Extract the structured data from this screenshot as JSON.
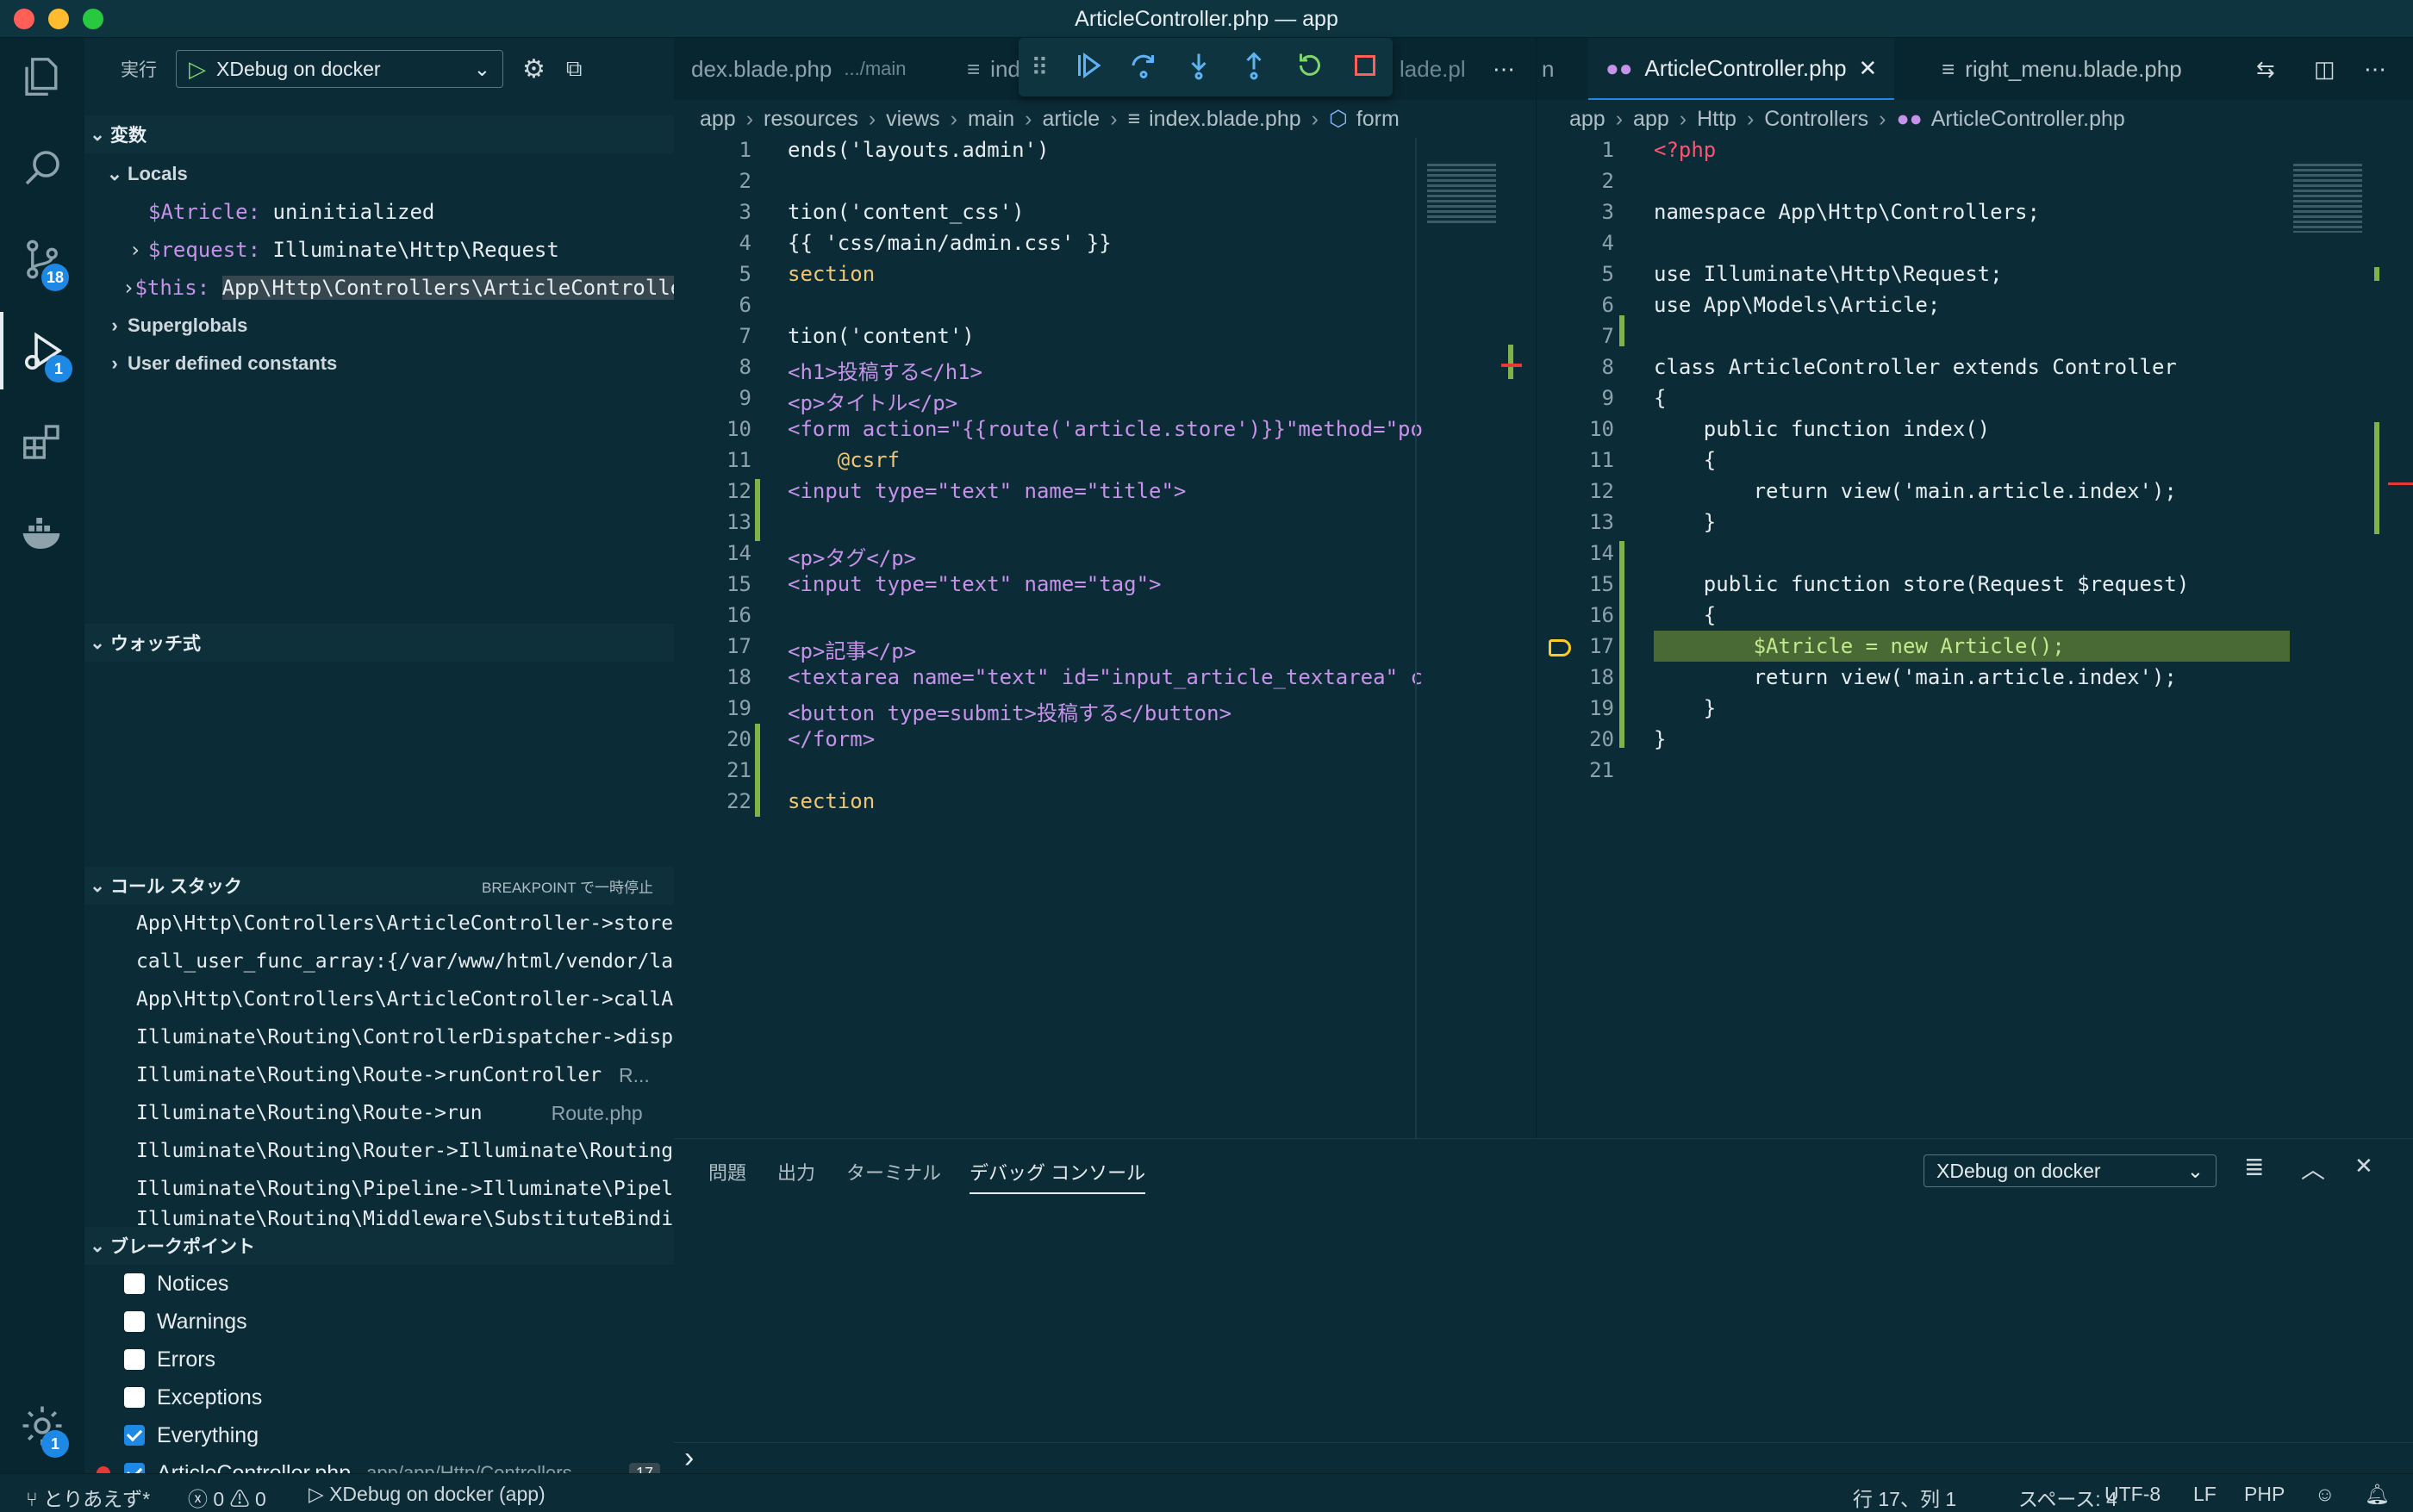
{
  "window": {
    "title": "ArticleController.php — app"
  },
  "activity_bar": {
    "scm_badge": "18",
    "debug_badge": "1",
    "settings_badge": "1"
  },
  "run_panel": {
    "run_label": "実行",
    "config": "XDebug on docker",
    "variables_header": "変数",
    "locals_label": "Locals",
    "locals": [
      {
        "name": "$Atricle:",
        "value": "uninitialized"
      },
      {
        "name": "$request:",
        "value": "Illuminate\\Http\\Request"
      },
      {
        "name": "$this:",
        "value": "App\\Http\\Controllers\\ArticleController"
      }
    ],
    "superglobals": "Superglobals",
    "user_constants": "User defined constants",
    "watch_header": "ウォッチ式",
    "callstack_header": "コール スタック",
    "callstack_status": "BREAKPOINT で一時停止",
    "callstack": [
      {
        "text": "App\\Http\\Controllers\\ArticleController->store",
        "file": ""
      },
      {
        "text": "call_user_func_array:{/var/www/html/vendor/lara",
        "file": ""
      },
      {
        "text": "App\\Http\\Controllers\\ArticleController->callAct",
        "file": ""
      },
      {
        "text": "Illuminate\\Routing\\ControllerDispatcher->dispatc",
        "file": ""
      },
      {
        "text": "Illuminate\\Routing\\Route->runController",
        "file": "R..."
      },
      {
        "text": "Illuminate\\Routing\\Route->run",
        "file": "Route.php"
      },
      {
        "text": "Illuminate\\Routing\\Router->Illuminate\\Routing\\{c",
        "file": ""
      },
      {
        "text": "Illuminate\\Routing\\Pipeline->Illuminate\\Pipeline",
        "file": ""
      },
      {
        "text": "Illuminate\\Routing\\Middleware\\SubstituteBinding",
        "file": ""
      }
    ],
    "breakpoints_header": "ブレークポイント",
    "breakpoints": [
      {
        "label": "Notices",
        "checked": false
      },
      {
        "label": "Warnings",
        "checked": false
      },
      {
        "label": "Errors",
        "checked": false
      },
      {
        "label": "Exceptions",
        "checked": false
      },
      {
        "label": "Everything",
        "checked": true
      }
    ],
    "file_breakpoint": {
      "file": "ArticleController.php",
      "path": "app/app/Http/Controllers",
      "line": "17"
    }
  },
  "editor_left": {
    "tab1": "dex.blade.php",
    "tab1_path": ".../main",
    "tab2": "ind",
    "tab3": "lade.pl",
    "breadcrumb": [
      "app",
      "resources",
      "views",
      "main",
      "article",
      "index.blade.php",
      "form"
    ],
    "lines": [
      {
        "n": "1",
        "t": "ends('layouts.admin')"
      },
      {
        "n": "2",
        "t": ""
      },
      {
        "n": "3",
        "t": "tion('content_css')"
      },
      {
        "n": "4",
        "t": "{{ 'css/main/admin.css' }}"
      },
      {
        "n": "5",
        "t": "section"
      },
      {
        "n": "6",
        "t": ""
      },
      {
        "n": "7",
        "t": "tion('content')"
      },
      {
        "n": "8",
        "t": "<h1>投稿する</h1>"
      },
      {
        "n": "9",
        "t": "<p>タイトル</p>"
      },
      {
        "n": "10",
        "t": "<form action=\"{{route('article.store')}}\"method=\"po"
      },
      {
        "n": "11",
        "t": "    @csrf"
      },
      {
        "n": "12",
        "t": "<input type=\"text\" name=\"title\">"
      },
      {
        "n": "13",
        "t": ""
      },
      {
        "n": "14",
        "t": "<p>タグ</p>"
      },
      {
        "n": "15",
        "t": "<input type=\"text\" name=\"tag\">"
      },
      {
        "n": "16",
        "t": ""
      },
      {
        "n": "17",
        "t": "<p>記事</p>"
      },
      {
        "n": "18",
        "t": "<textarea name=\"text\" id=\"input_article_textarea\" c"
      },
      {
        "n": "19",
        "t": "<button type=submit>投稿する</button>"
      },
      {
        "n": "20",
        "t": "</form>"
      },
      {
        "n": "21",
        "t": ""
      },
      {
        "n": "22",
        "t": "section"
      }
    ]
  },
  "editor_right": {
    "tab_active": "ArticleController.php",
    "tab2": "right_menu.blade.php",
    "tab_overflow": "n",
    "breadcrumb": [
      "app",
      "app",
      "Http",
      "Controllers",
      "ArticleController.php"
    ],
    "lines": [
      {
        "n": "1",
        "t": "<?php"
      },
      {
        "n": "2",
        "t": ""
      },
      {
        "n": "3",
        "t": "namespace App\\Http\\Controllers;"
      },
      {
        "n": "4",
        "t": ""
      },
      {
        "n": "5",
        "t": "use Illuminate\\Http\\Request;"
      },
      {
        "n": "6",
        "t": "use App\\Models\\Article;"
      },
      {
        "n": "7",
        "t": ""
      },
      {
        "n": "8",
        "t": "class ArticleController extends Controller"
      },
      {
        "n": "9",
        "t": "{"
      },
      {
        "n": "10",
        "t": "    public function index()"
      },
      {
        "n": "11",
        "t": "    {"
      },
      {
        "n": "12",
        "t": "        return view('main.article.index');"
      },
      {
        "n": "13",
        "t": "    }"
      },
      {
        "n": "14",
        "t": ""
      },
      {
        "n": "15",
        "t": "    public function store(Request $request)"
      },
      {
        "n": "16",
        "t": "    {"
      },
      {
        "n": "17",
        "t": "        $Atricle = new Article();"
      },
      {
        "n": "18",
        "t": "        return view('main.article.index');"
      },
      {
        "n": "19",
        "t": "    }"
      },
      {
        "n": "20",
        "t": "}"
      },
      {
        "n": "21",
        "t": ""
      }
    ]
  },
  "panel": {
    "tabs": [
      "問題",
      "出力",
      "ターミナル",
      "デバッグ コンソール"
    ],
    "config": "XDebug on docker",
    "prompt": "›"
  },
  "status_bar": {
    "branch": "とりあえず*",
    "errors": "0",
    "warnings": "0",
    "debug": "XDebug on docker (app)",
    "position": "行 17、列 1",
    "spaces": "スペース: 4",
    "encoding": "UTF-8",
    "eol": "LF",
    "language": "PHP"
  },
  "colors": {
    "accent": "#1e88e5",
    "background": "#0b2b36",
    "highlight_line": "#4a6a35",
    "breakpoint": "#e53935"
  }
}
